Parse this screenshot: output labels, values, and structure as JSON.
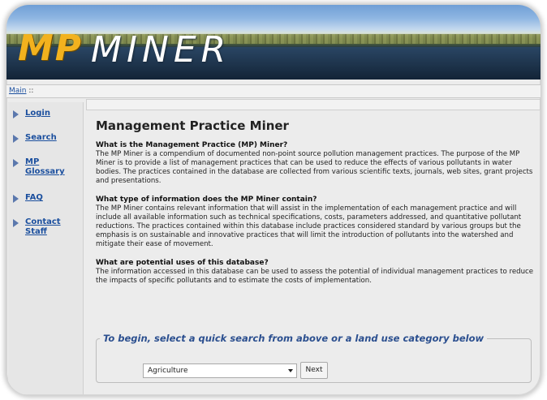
{
  "logo": {
    "part1": "MP",
    "part2": "MINER"
  },
  "breadcrumb": {
    "main": "Main",
    "separator": "::"
  },
  "sidebar": {
    "items": [
      {
        "label": "Login"
      },
      {
        "label": "Search"
      },
      {
        "label": "MP Glossary"
      },
      {
        "label": "FAQ"
      },
      {
        "label": "Contact Staff"
      }
    ]
  },
  "main": {
    "title": "Management Practice Miner",
    "sections": [
      {
        "heading": "What is the Management Practice (MP) Miner?",
        "body": "The MP Miner is a compendium of documented non-point source pollution management practices. The purpose of the MP Miner is to provide a list of management practices that can be used to reduce the effects of various pollutants in water bodies. The practices contained in the database are collected from various scientific texts, journals, web sites, grant projects and presentations."
      },
      {
        "heading": "What type of information does the MP Miner contain?",
        "body": "The MP Miner contains relevant information that will assist in the implementation of each management practice and will include all available information such as technical specifications, costs, parameters addressed, and quantitative pollutant reductions. The practices contained within this database include practices considered standard by various groups but the emphasis is on sustainable and innovative practices that will limit the introduction of pollutants into the watershed and mitigate their ease of movement."
      },
      {
        "heading": "What are potential uses of this database?",
        "body": "The information accessed in this database can be used to assess the potential of individual management practices to reduce the impacts of specific pollutants and to estimate the costs of implementation."
      }
    ]
  },
  "quick_search": {
    "legend": "To begin, select a quick search from above or a land use category below",
    "selected": "Agriculture",
    "next_label": "Next"
  }
}
